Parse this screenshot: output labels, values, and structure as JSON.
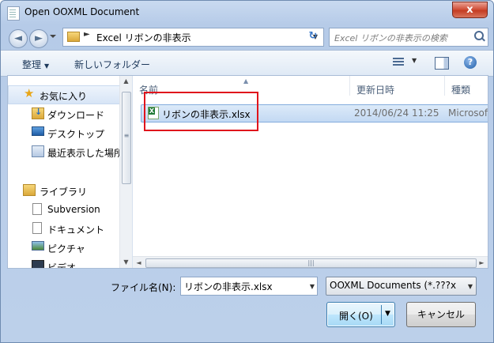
{
  "window": {
    "title": "Open OOXML Document",
    "close_glyph": "x"
  },
  "nav": {
    "back_glyph": "◄",
    "forward_glyph": "►"
  },
  "address": {
    "separator": "►",
    "path": "Excel リボンの非表示",
    "dropdown_glyph": "▼",
    "refresh_glyph": "↻"
  },
  "search": {
    "placeholder": "Excel リボンの非表示の検索"
  },
  "toolbar": {
    "organize_label": "整理",
    "organize_caret": "▼",
    "new_folder_label": "新しいフォルダー",
    "view_caret": "▼",
    "help_glyph": "?"
  },
  "sidebar": {
    "items": [
      {
        "label": "お気に入り",
        "icon": "star-icon",
        "glyph": "★"
      },
      {
        "label": "ダウンロード",
        "icon": "downloads-icon"
      },
      {
        "label": "デスクトップ",
        "icon": "desktop-icon"
      },
      {
        "label": "最近表示した場所",
        "icon": "recent-places-icon"
      },
      {
        "label": "ライブラリ",
        "icon": "library-icon"
      },
      {
        "label": "Subversion",
        "icon": "document-icon"
      },
      {
        "label": "ドキュメント",
        "icon": "document-icon"
      },
      {
        "label": "ピクチャ",
        "icon": "pictures-icon"
      },
      {
        "label": "ビデオ",
        "icon": "video-icon"
      }
    ],
    "scroll_up": "▲",
    "scroll_down": "▼",
    "grip": "≡"
  },
  "file_list": {
    "columns": [
      "名前",
      "更新日時",
      "種類"
    ],
    "sort_glyph": "▲",
    "rows": [
      {
        "name": "リボンの非表示.xlsx",
        "modified": "2014/06/24 11:25",
        "type": "Microsoft",
        "icon": "excel-file-icon"
      }
    ],
    "hscroll_left": "◄",
    "hscroll_right": "►",
    "hscroll_grip": "|||"
  },
  "footer": {
    "filename_label": "ファイル名(N):",
    "filename_value": "リボンの非表示.xlsx",
    "filename_drop": "▼",
    "filetype_value": "OOXML Documents (*.???x;",
    "filetype_drop": "▼",
    "open_label": "開く(O)",
    "open_caret": "▼",
    "cancel_label": "キャンセル"
  },
  "colors": {
    "highlight_box": "#e0141c",
    "selection": "#c3d9f3",
    "title_bar": "#b6cbe8"
  }
}
